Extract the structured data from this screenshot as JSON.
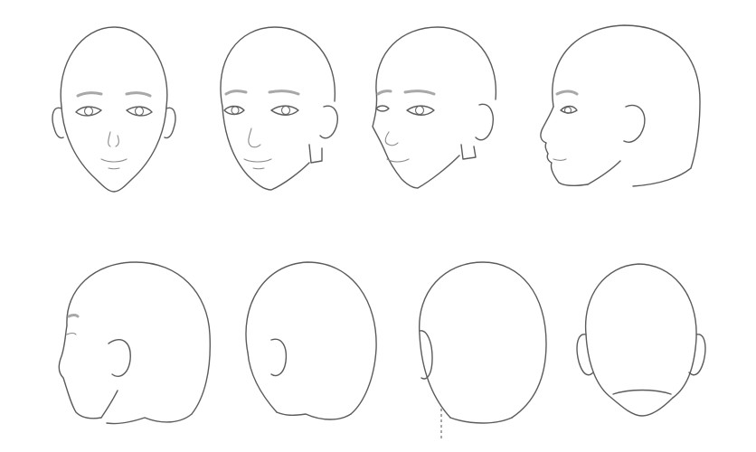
{
  "sheet": {
    "views": [
      {
        "id": "front",
        "row": 1
      },
      {
        "id": "three-quarter-front-slight",
        "row": 1
      },
      {
        "id": "three-quarter-front",
        "row": 1
      },
      {
        "id": "profile-left",
        "row": 1
      },
      {
        "id": "back-three-quarter-left",
        "row": 2
      },
      {
        "id": "back-three-quarter",
        "row": 2
      },
      {
        "id": "back-slight-turn",
        "row": 2
      },
      {
        "id": "back",
        "row": 2
      }
    ],
    "colors": {
      "line": "#5b5b5b",
      "brow": "#a8a8a8",
      "paper": "#ffffff"
    }
  }
}
